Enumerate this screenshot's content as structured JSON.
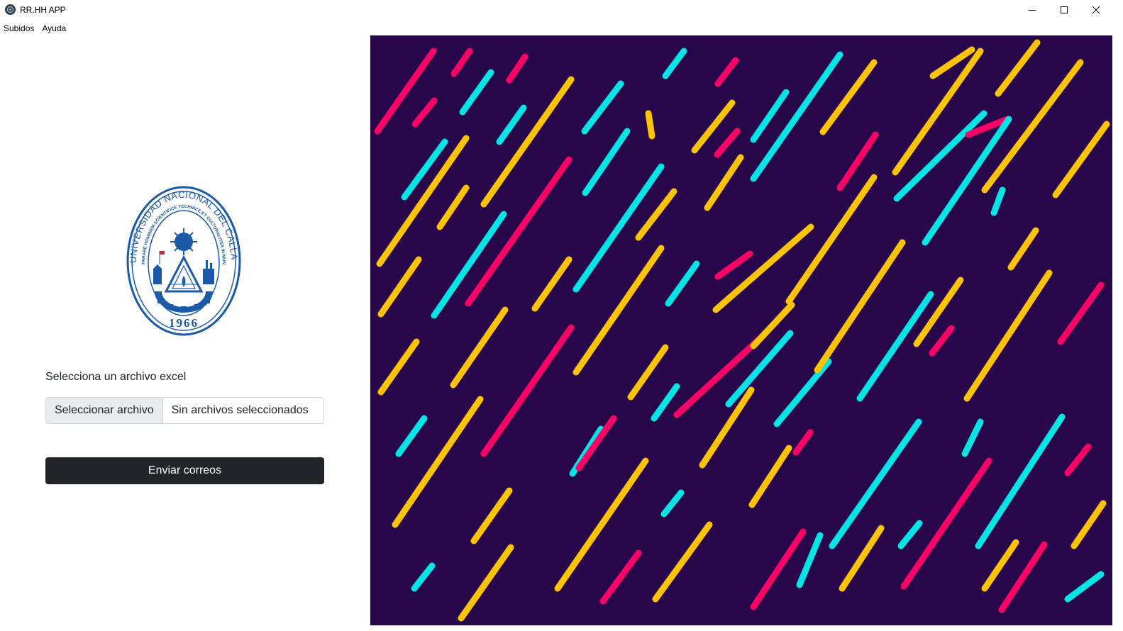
{
  "window": {
    "title": "RR.HH APP",
    "controls": [
      "minimize-icon",
      "maximize-icon",
      "close-icon"
    ]
  },
  "menu": {
    "items": [
      {
        "label": "Subidos"
      },
      {
        "label": "Ayuda"
      }
    ]
  },
  "logo": {
    "outer_text": "UNIVERSIDAD NACIONAL DEL CALLAO",
    "inner_text": "PARARE HOMINEM SCIENTIFICE TECHNICE ET CULTURALITER IN MUNDUM MELIOREM",
    "year": "1966",
    "color": "#1b5aa8"
  },
  "form": {
    "file_label": "Selecciona un archivo excel",
    "file_button": "Seleccionar archivo",
    "file_status": "Sin archivos seleccionados",
    "submit_label": "Enviar correos"
  },
  "artwork": {
    "background": "#27064a",
    "stroke_colors": [
      "#ff0066",
      "#00e5e5",
      "#ffc400"
    ]
  }
}
